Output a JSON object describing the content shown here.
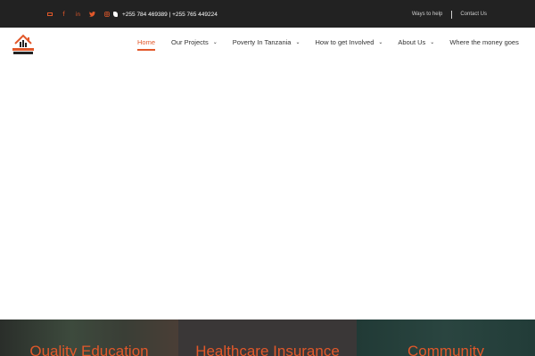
{
  "topbar": {
    "social_icons": [
      "envelope-icon",
      "facebook-icon",
      "linkedin-icon",
      "twitter-icon",
      "instagram-icon"
    ],
    "phone_icon": "phone-icon",
    "phone_text": "+255 784 469389 | +255 765 449224",
    "links": [
      "Ways to help",
      "Contact Us"
    ]
  },
  "header": {
    "logo_alt": "Tuleeni Orphanage Centre",
    "nav": [
      {
        "label": "Home",
        "dropdown": false,
        "active": true
      },
      {
        "label": "Our Projects",
        "dropdown": true,
        "active": false
      },
      {
        "label": "Poverty In Tanzania",
        "dropdown": true,
        "active": false
      },
      {
        "label": "How to get Involved",
        "dropdown": true,
        "active": false
      },
      {
        "label": "About Us",
        "dropdown": true,
        "active": false
      },
      {
        "label": "Where the money goes",
        "dropdown": false,
        "active": false
      }
    ]
  },
  "features": [
    {
      "title": "Quality Education"
    },
    {
      "title": "Healthcare Insurance"
    },
    {
      "title": "Community"
    }
  ],
  "colors": {
    "accent": "#e2582a",
    "topbar_bg": "#222222",
    "nav_text": "#333333"
  }
}
